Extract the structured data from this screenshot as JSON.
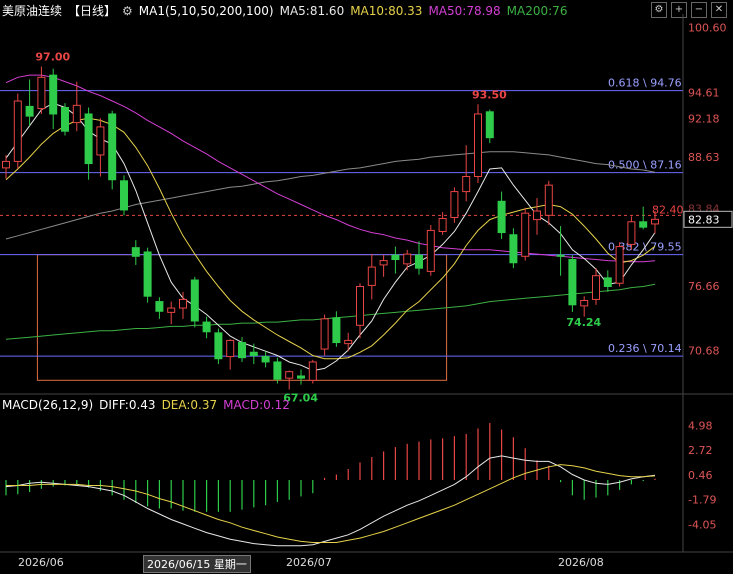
{
  "header": {
    "symbol": "美原油连续",
    "period": "【日线】",
    "ma_label": "MA1(5,10,50,200,100)",
    "ma5": "MA5:81.60",
    "ma10": "MA10:80.33",
    "ma50": "MA50:78.98",
    "ma200": "MA200:76"
  },
  "toolbar_icons": [
    "gear-icon",
    "plus-icon",
    "minus-icon",
    "close-icon"
  ],
  "macd_header": {
    "label": "MACD(26,12,9)",
    "diff": "DIFF:0.43",
    "dea": "DEA:0.37",
    "macd": "MACD:0.12"
  },
  "x_axis": {
    "ticks": [
      "2026/06",
      "2026/07",
      "2026/08"
    ],
    "highlight": "2026/06/15 星期一"
  },
  "colors": {
    "up": "#e84545",
    "down": "#2ecc4a",
    "ma5": "#e8e8e8",
    "ma10": "#e6d24a",
    "ma50": "#d43fd4",
    "ma200": "#8a8a8a",
    "ma100": "#3cb043",
    "fib": "#6b6bff",
    "box": "#e07040",
    "price_tag": "#e84545"
  },
  "chart_data": {
    "type": "candlestick",
    "ylim": [
      67.0,
      101.5
    ],
    "y_ticks": [
      100.6,
      94.61,
      92.18,
      88.63,
      82.83,
      76.66,
      70.68
    ],
    "last_price": 82.83,
    "dashed_price_label": "82.40",
    "partial_tick_label": "83.84",
    "fib_levels": [
      {
        "label": "0.618 \\ 94.76",
        "value": 94.76
      },
      {
        "label": "0.500 \\ 87.16",
        "value": 87.16
      },
      {
        "label": "0.382 \\ 79.55",
        "value": 79.55
      },
      {
        "label": "0.236 \\ 70.14",
        "value": 70.14
      }
    ],
    "annotations": [
      {
        "text": "97.00",
        "value": 97.0,
        "color": "#e84545"
      },
      {
        "text": "93.50",
        "value": 93.5,
        "color": "#e84545"
      },
      {
        "text": "67.04",
        "value": 67.04,
        "color": "#2ecc4a"
      },
      {
        "text": "74.24",
        "value": 74.24,
        "color": "#2ecc4a"
      }
    ],
    "box": {
      "start_index": 3,
      "end_index": 37,
      "top": 79.55,
      "bottom": 67.9
    },
    "candles": [
      {
        "o": 87.6,
        "h": 88.8,
        "l": 86.6,
        "c": 88.2
      },
      {
        "o": 88.2,
        "h": 94.5,
        "l": 87.5,
        "c": 93.8
      },
      {
        "o": 93.3,
        "h": 95.8,
        "l": 91.5,
        "c": 92.4
      },
      {
        "o": 93.1,
        "h": 97.0,
        "l": 92.6,
        "c": 96.0
      },
      {
        "o": 96.2,
        "h": 96.8,
        "l": 91.2,
        "c": 92.6
      },
      {
        "o": 93.2,
        "h": 93.6,
        "l": 90.6,
        "c": 91.0
      },
      {
        "o": 91.8,
        "h": 95.6,
        "l": 91.0,
        "c": 93.4
      },
      {
        "o": 92.6,
        "h": 93.2,
        "l": 86.5,
        "c": 88.0
      },
      {
        "o": 88.8,
        "h": 92.2,
        "l": 86.8,
        "c": 91.4
      },
      {
        "o": 92.6,
        "h": 92.9,
        "l": 85.6,
        "c": 86.5
      },
      {
        "o": 86.4,
        "h": 86.9,
        "l": 83.2,
        "c": 83.7
      },
      {
        "o": 80.2,
        "h": 80.9,
        "l": 78.6,
        "c": 79.4
      },
      {
        "o": 79.8,
        "h": 80.2,
        "l": 75.1,
        "c": 75.7
      },
      {
        "o": 75.2,
        "h": 75.6,
        "l": 73.6,
        "c": 74.3
      },
      {
        "o": 74.2,
        "h": 75.2,
        "l": 73.1,
        "c": 74.6
      },
      {
        "o": 74.6,
        "h": 76.1,
        "l": 73.6,
        "c": 75.4
      },
      {
        "o": 77.2,
        "h": 77.5,
        "l": 72.8,
        "c": 73.4
      },
      {
        "o": 73.3,
        "h": 73.8,
        "l": 71.8,
        "c": 72.4
      },
      {
        "o": 72.3,
        "h": 72.7,
        "l": 69.4,
        "c": 69.9
      },
      {
        "o": 70.1,
        "h": 71.7,
        "l": 68.9,
        "c": 71.6
      },
      {
        "o": 71.4,
        "h": 71.9,
        "l": 69.6,
        "c": 70.0
      },
      {
        "o": 70.5,
        "h": 71.3,
        "l": 69.4,
        "c": 70.2
      },
      {
        "o": 70.1,
        "h": 70.6,
        "l": 69.1,
        "c": 69.6
      },
      {
        "o": 69.6,
        "h": 70.0,
        "l": 67.6,
        "c": 68.0
      },
      {
        "o": 68.1,
        "h": 68.8,
        "l": 67.04,
        "c": 68.7
      },
      {
        "o": 68.3,
        "h": 68.9,
        "l": 67.5,
        "c": 68.1
      },
      {
        "o": 67.9,
        "h": 69.8,
        "l": 67.6,
        "c": 69.6
      },
      {
        "o": 70.8,
        "h": 74.0,
        "l": 70.2,
        "c": 73.6
      },
      {
        "o": 73.7,
        "h": 74.3,
        "l": 71.0,
        "c": 71.4
      },
      {
        "o": 71.3,
        "h": 72.3,
        "l": 70.6,
        "c": 71.6
      },
      {
        "o": 73.0,
        "h": 76.9,
        "l": 71.8,
        "c": 76.6
      },
      {
        "o": 76.7,
        "h": 79.6,
        "l": 75.4,
        "c": 78.4
      },
      {
        "o": 78.6,
        "h": 79.5,
        "l": 77.5,
        "c": 79.0
      },
      {
        "o": 79.5,
        "h": 80.3,
        "l": 77.8,
        "c": 79.1
      },
      {
        "o": 78.7,
        "h": 80.0,
        "l": 78.1,
        "c": 79.6
      },
      {
        "o": 79.5,
        "h": 80.8,
        "l": 77.7,
        "c": 78.3
      },
      {
        "o": 78.0,
        "h": 82.3,
        "l": 77.6,
        "c": 81.8
      },
      {
        "o": 81.7,
        "h": 83.5,
        "l": 81.4,
        "c": 82.9
      },
      {
        "o": 83.0,
        "h": 85.8,
        "l": 82.5,
        "c": 85.4
      },
      {
        "o": 85.4,
        "h": 89.7,
        "l": 84.5,
        "c": 86.8
      },
      {
        "o": 86.8,
        "h": 93.5,
        "l": 86.2,
        "c": 92.6
      },
      {
        "o": 92.8,
        "h": 93.0,
        "l": 89.9,
        "c": 90.4
      },
      {
        "o": 84.5,
        "h": 85.4,
        "l": 81.0,
        "c": 81.6
      },
      {
        "o": 81.4,
        "h": 82.0,
        "l": 78.3,
        "c": 78.8
      },
      {
        "o": 79.4,
        "h": 83.9,
        "l": 79.0,
        "c": 83.4
      },
      {
        "o": 82.8,
        "h": 84.8,
        "l": 81.4,
        "c": 83.6
      },
      {
        "o": 83.2,
        "h": 86.4,
        "l": 82.3,
        "c": 86.0
      },
      {
        "o": 79.5,
        "h": 82.2,
        "l": 77.6,
        "c": 79.4
      },
      {
        "o": 79.1,
        "h": 79.5,
        "l": 74.24,
        "c": 74.9
      },
      {
        "o": 74.8,
        "h": 75.7,
        "l": 73.8,
        "c": 75.3
      },
      {
        "o": 75.4,
        "h": 78.3,
        "l": 74.9,
        "c": 77.6
      },
      {
        "o": 77.4,
        "h": 78.1,
        "l": 76.1,
        "c": 76.6
      },
      {
        "o": 76.9,
        "h": 80.7,
        "l": 76.6,
        "c": 80.3
      },
      {
        "o": 80.5,
        "h": 83.1,
        "l": 80.0,
        "c": 82.6
      },
      {
        "o": 82.6,
        "h": 84.0,
        "l": 81.9,
        "c": 82.1
      },
      {
        "o": 82.4,
        "h": 83.6,
        "l": 81.5,
        "c": 82.83
      }
    ],
    "ma5": [
      88.5,
      90.0,
      91.5,
      93.0,
      93.6,
      93.2,
      92.4,
      91.0,
      90.3,
      89.8,
      88.0,
      85.5,
      82.5,
      79.5,
      77.0,
      75.5,
      74.8,
      74.0,
      73.0,
      72.0,
      71.4,
      71.0,
      70.6,
      70.2,
      69.6,
      69.3,
      68.8,
      69.0,
      69.7,
      70.7,
      72.1,
      73.4,
      75.4,
      77.0,
      78.4,
      78.9,
      79.5,
      80.5,
      81.7,
      83.4,
      85.4,
      87.5,
      87.6,
      86.0,
      84.6,
      83.2,
      82.5,
      81.5,
      80.0,
      79.2,
      78.2,
      76.8,
      77.0,
      78.6,
      80.0,
      81.6
    ],
    "ma10": [
      86.5,
      87.5,
      88.6,
      89.8,
      90.8,
      91.5,
      92.0,
      92.2,
      92.0,
      91.6,
      90.9,
      89.5,
      87.8,
      85.7,
      83.4,
      81.3,
      79.6,
      78.0,
      76.6,
      75.3,
      74.3,
      73.5,
      72.8,
      72.1,
      71.5,
      70.9,
      70.2,
      69.9,
      69.9,
      70.0,
      70.5,
      71.1,
      72.1,
      73.2,
      74.4,
      75.2,
      76.3,
      77.4,
      78.7,
      80.4,
      81.8,
      82.8,
      83.2,
      83.5,
      83.8,
      84.0,
      84.2,
      84.0,
      83.3,
      82.2,
      81.0,
      79.7,
      78.8,
      79.0,
      79.5,
      80.33
    ],
    "ma50": [
      95.5,
      96.0,
      96.2,
      96.2,
      96.0,
      95.6,
      95.2,
      94.7,
      94.3,
      93.8,
      93.3,
      92.7,
      92.0,
      91.4,
      90.8,
      90.1,
      89.5,
      88.9,
      88.2,
      87.6,
      87.0,
      86.4,
      85.8,
      85.2,
      84.7,
      84.2,
      83.7,
      83.2,
      82.8,
      82.3,
      81.9,
      81.6,
      81.4,
      81.1,
      80.9,
      80.6,
      80.4,
      80.2,
      80.1,
      80.0,
      80.0,
      80.0,
      79.9,
      79.8,
      79.7,
      79.6,
      79.5,
      79.4,
      79.3,
      79.2,
      79.1,
      79.0,
      78.95,
      78.9,
      78.9,
      78.98
    ],
    "ma200": [
      81.0,
      81.3,
      81.6,
      81.9,
      82.2,
      82.5,
      82.8,
      83.1,
      83.4,
      83.6,
      83.9,
      84.2,
      84.4,
      84.6,
      84.8,
      85.0,
      85.2,
      85.4,
      85.6,
      85.8,
      85.9,
      86.1,
      86.3,
      86.4,
      86.6,
      86.8,
      86.9,
      87.1,
      87.3,
      87.5,
      87.6,
      87.8,
      88.0,
      88.2,
      88.3,
      88.4,
      88.6,
      88.7,
      88.8,
      88.9,
      89.0,
      89.1,
      89.1,
      89.1,
      89.0,
      88.9,
      88.8,
      88.6,
      88.4,
      88.2,
      88.0,
      87.9,
      87.7,
      87.5,
      87.4,
      87.2
    ],
    "ma100": [
      71.7,
      71.8,
      71.9,
      72.0,
      72.1,
      72.2,
      72.3,
      72.4,
      72.5,
      72.5,
      72.6,
      72.7,
      72.7,
      72.8,
      72.9,
      72.9,
      73.0,
      73.0,
      73.1,
      73.1,
      73.2,
      73.2,
      73.3,
      73.3,
      73.4,
      73.5,
      73.5,
      73.6,
      73.7,
      73.8,
      73.9,
      74.0,
      74.1,
      74.2,
      74.3,
      74.4,
      74.5,
      74.6,
      74.7,
      74.8,
      75.0,
      75.2,
      75.3,
      75.4,
      75.5,
      75.6,
      75.7,
      75.8,
      75.9,
      76.0,
      76.1,
      76.2,
      76.3,
      76.5,
      76.6,
      76.8
    ],
    "macd": {
      "label": "MACD(26,12,9)",
      "ylim": [
        -6.2,
        6.2
      ],
      "y_ticks": [
        4.98,
        2.72,
        0.46,
        -1.79,
        -4.05
      ],
      "diff": [
        -0.6,
        -0.5,
        -0.3,
        -0.2,
        -0.3,
        -0.4,
        -0.5,
        -0.6,
        -0.8,
        -1.0,
        -1.4,
        -2.0,
        -2.6,
        -3.1,
        -3.6,
        -4.0,
        -4.4,
        -4.8,
        -5.1,
        -5.4,
        -5.6,
        -5.8,
        -5.9,
        -6.0,
        -6.0,
        -6.0,
        -5.9,
        -5.6,
        -5.3,
        -5.0,
        -4.5,
        -3.9,
        -3.3,
        -2.8,
        -2.3,
        -1.9,
        -1.4,
        -0.9,
        -0.4,
        0.3,
        1.2,
        2.0,
        2.2,
        2.0,
        1.8,
        1.7,
        1.7,
        1.2,
        0.5,
        0.0,
        -0.3,
        -0.4,
        -0.2,
        0.1,
        0.3,
        0.43
      ],
      "dea": [
        -0.5,
        -0.5,
        -0.5,
        -0.4,
        -0.4,
        -0.4,
        -0.4,
        -0.5,
        -0.5,
        -0.6,
        -0.8,
        -1.0,
        -1.3,
        -1.7,
        -2.0,
        -2.4,
        -2.8,
        -3.2,
        -3.6,
        -3.9,
        -4.3,
        -4.6,
        -4.9,
        -5.2,
        -5.4,
        -5.6,
        -5.7,
        -5.7,
        -5.7,
        -5.5,
        -5.3,
        -5.0,
        -4.7,
        -4.3,
        -3.9,
        -3.5,
        -3.1,
        -2.7,
        -2.3,
        -1.8,
        -1.3,
        -0.8,
        -0.3,
        0.2,
        0.6,
        0.9,
        1.2,
        1.4,
        1.3,
        1.1,
        0.8,
        0.6,
        0.4,
        0.3,
        0.3,
        0.37
      ],
      "hist": [
        -1.4,
        -1.3,
        -1.1,
        -0.8,
        -0.6,
        -0.5,
        -0.4,
        -0.7,
        -1.0,
        -1.4,
        -1.8,
        -2.1,
        -2.4,
        -2.6,
        -2.6,
        -2.8,
        -2.9,
        -2.9,
        -2.9,
        -2.9,
        -2.7,
        -2.5,
        -2.3,
        -2.0,
        -1.8,
        -1.5,
        -1.2,
        0.2,
        0.5,
        1.0,
        1.6,
        2.1,
        2.6,
        3.0,
        3.3,
        3.5,
        3.7,
        3.8,
        4.0,
        4.2,
        4.7,
        5.2,
        4.6,
        3.9,
        2.9,
        1.8,
        1.3,
        -0.2,
        -1.4,
        -1.8,
        -1.6,
        -1.4,
        -0.9,
        -0.4,
        -0.1,
        0.12
      ]
    }
  }
}
